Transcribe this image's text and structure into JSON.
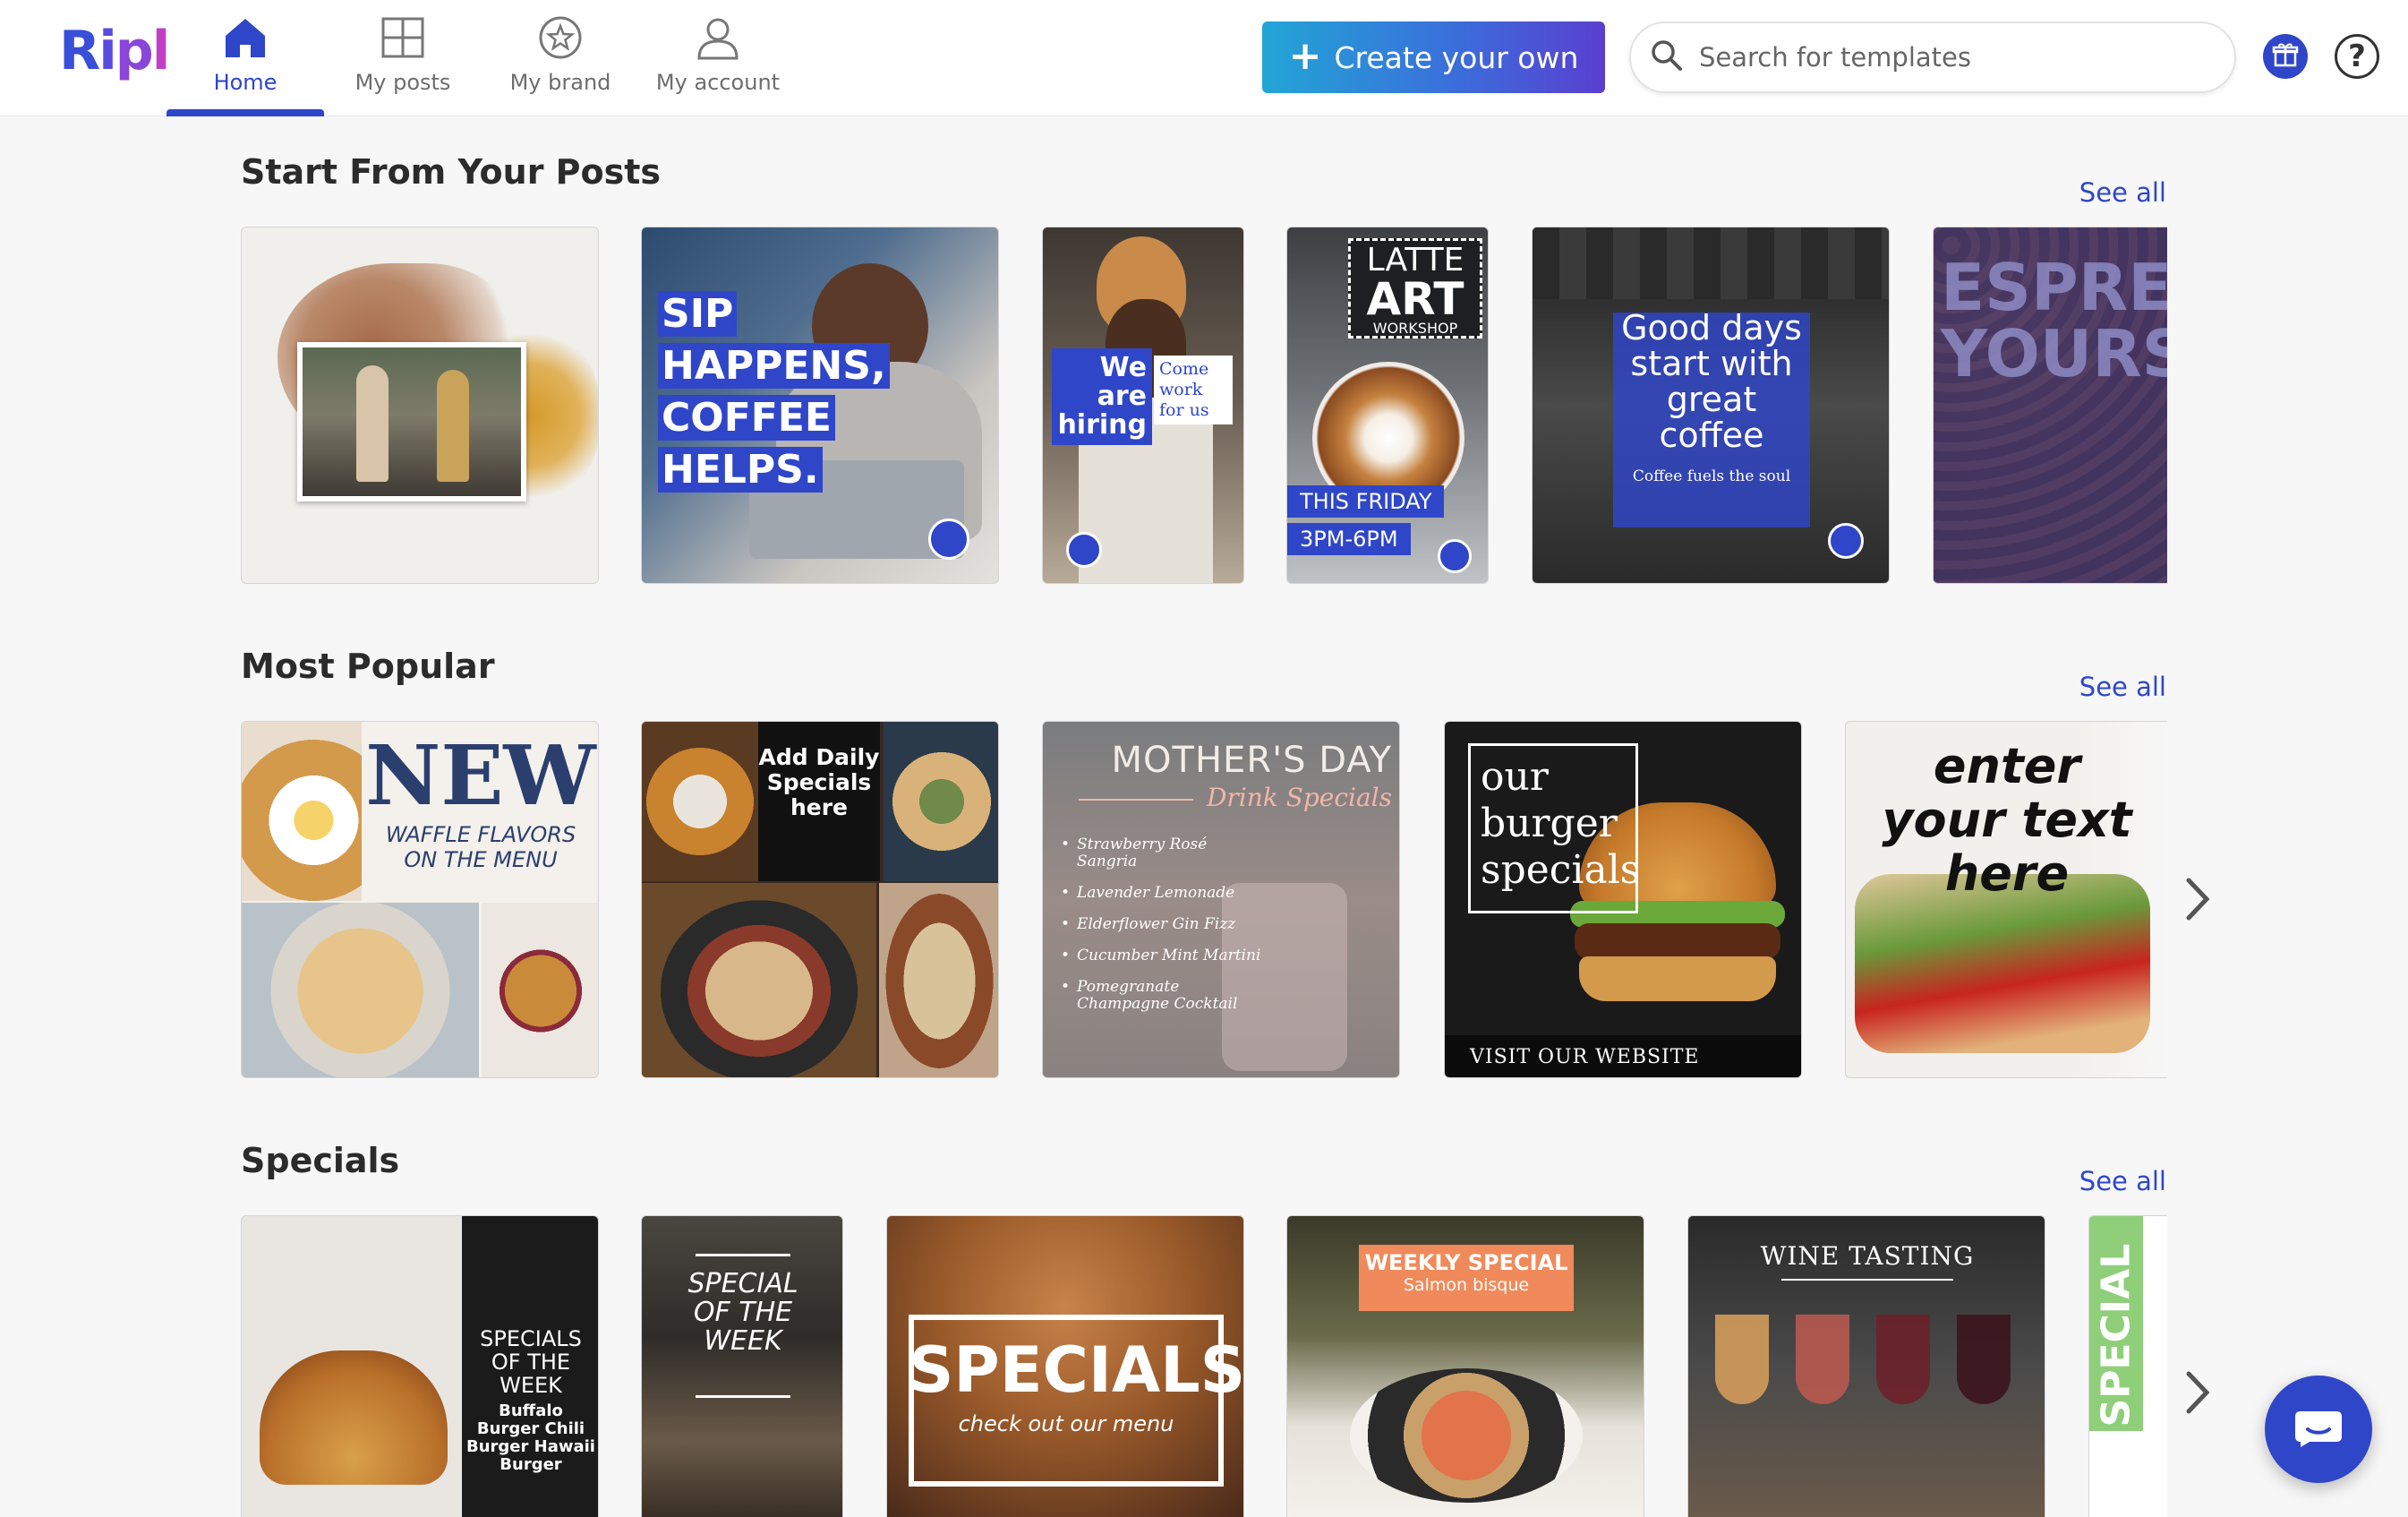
{
  "app": {
    "logo": "Ripl"
  },
  "nav": {
    "home": "Home",
    "my_posts": "My posts",
    "my_brand": "My brand",
    "my_account": "My account"
  },
  "header": {
    "create_label": "Create your own",
    "search_placeholder": "Search for templates"
  },
  "sections": {
    "posts": {
      "title": "Start From Your Posts",
      "see_all": "See all",
      "tiles": {
        "t2": {
          "line1": "SIP",
          "line2": "HAPPENS,",
          "line3": "COFFEE",
          "line4": "HELPS."
        },
        "t3": {
          "left": "We are hiring",
          "right": "Come work for us"
        },
        "t4": {
          "title1": "LATTE",
          "title2": "ART",
          "title3": "WORKSHOP",
          "day": "THIS FRIDAY",
          "time": "3PM-6PM"
        },
        "t5": {
          "headline": "Good days start with great coffee",
          "sub": "Coffee fuels the soul"
        },
        "t6": {
          "text": "ESPRESS YOURSE"
        }
      }
    },
    "popular": {
      "title": "Most Popular",
      "see_all": "See all",
      "tiles": {
        "t1": {
          "big": "NEW",
          "sub": "WAFFLE FLAVORS ON THE MENU"
        },
        "t2": {
          "text": "Add Daily Specials here"
        },
        "t3": {
          "title": "MOTHER'S DAY",
          "subtitle": "Drink Specials",
          "items": [
            "Strawberry Rosé Sangria",
            "Lavender Lemonade",
            "Elderflower Gin Fizz",
            "Cucumber Mint Martini",
            "Pomegranate Champagne Cocktail"
          ]
        },
        "t4": {
          "text": "our burger specials",
          "footer": "VISIT OUR WEBSITE"
        },
        "t5": {
          "text": "enter your text here"
        }
      }
    },
    "specials": {
      "title": "Specials",
      "see_all": "See all",
      "tiles": {
        "t1": {
          "head": "SPECIALS OF THE WEEK",
          "items": "Buffalo Burger Chili Burger Hawaii Burger"
        },
        "t2": {
          "text": "SPECIAL OF THE WEEK"
        },
        "t3": {
          "big": "SPECIALS",
          "sub": "check out our menu"
        },
        "t4": {
          "head": "WEEKLY SPECIAL",
          "sub": "Salmon bisque"
        },
        "t5": {
          "text": "WINE TASTING"
        },
        "t6": {
          "text": "SPECIAL"
        }
      }
    }
  },
  "colors": {
    "accent": "#2f46c9",
    "brand_gradient_start": "#22a6d6",
    "brand_gradient_end": "#5a3fd0"
  }
}
